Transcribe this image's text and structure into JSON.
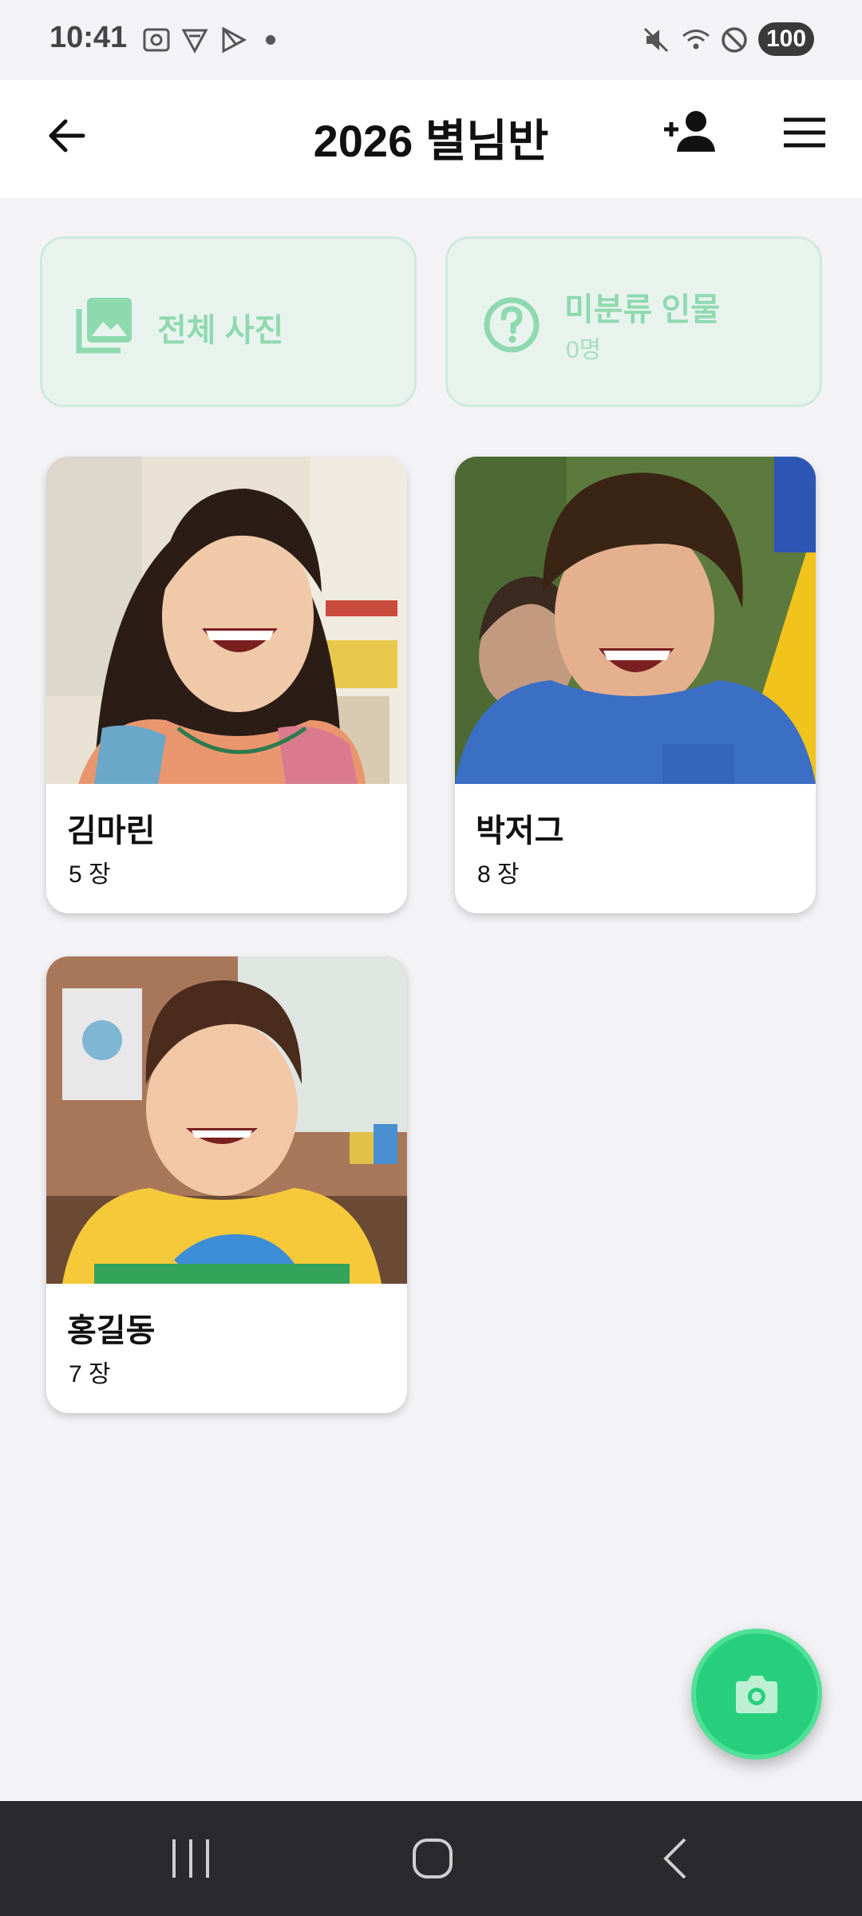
{
  "status": {
    "time": "10:41",
    "battery": "100",
    "icons": [
      "screenshot-icon",
      "shield-icon",
      "play-store-icon",
      "mute-icon",
      "wifi-icon",
      "do-not-disturb-icon"
    ]
  },
  "header": {
    "title": "2026 별님반",
    "back_icon": "arrow-left-icon",
    "add_person_icon": "person-add-icon",
    "menu_icon": "hamburger-menu-icon"
  },
  "shortcuts": [
    {
      "label": "전체 사진",
      "icon": "photo-library-icon"
    },
    {
      "label": "미분류 인물",
      "sub": "0명",
      "icon": "help-circle-icon"
    }
  ],
  "people": [
    {
      "name": "김마린",
      "count": "5 장"
    },
    {
      "name": "박저그",
      "count": "8 장"
    },
    {
      "name": "홍길동",
      "count": "7 장"
    }
  ],
  "fab": {
    "icon": "camera-icon"
  },
  "colors": {
    "accent": "#27cf7c",
    "card_tint": "#e8f3ee",
    "card_text": "#8fd9af"
  }
}
